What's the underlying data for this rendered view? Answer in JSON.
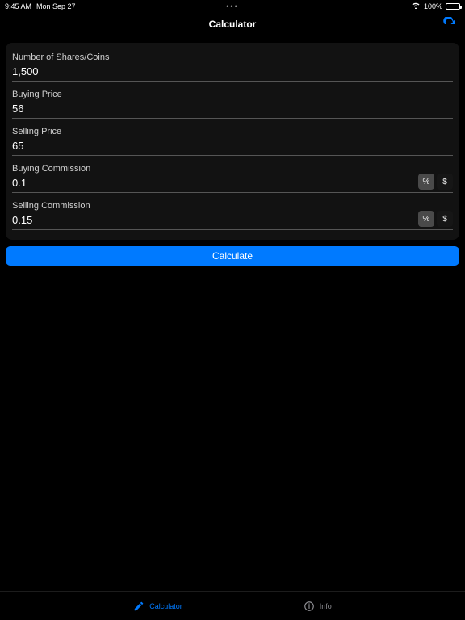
{
  "statusBar": {
    "time": "9:45 AM",
    "date": "Mon Sep 27",
    "battery": "100%"
  },
  "nav": {
    "title": "Calculator"
  },
  "form": {
    "shares": {
      "label": "Number of Shares/Coins",
      "value": "1,500"
    },
    "buyPrice": {
      "label": "Buying Price",
      "value": "56"
    },
    "sellPrice": {
      "label": "Selling Price",
      "value": "65"
    },
    "buyCommission": {
      "label": "Buying Commission",
      "value": "0.1"
    },
    "sellCommission": {
      "label": "Selling Commission",
      "value": "0.15"
    },
    "togglePercent": "%",
    "toggleDollar": "$",
    "calculate": "Calculate"
  },
  "tabs": {
    "calculator": "Calculator",
    "info": "Info"
  }
}
